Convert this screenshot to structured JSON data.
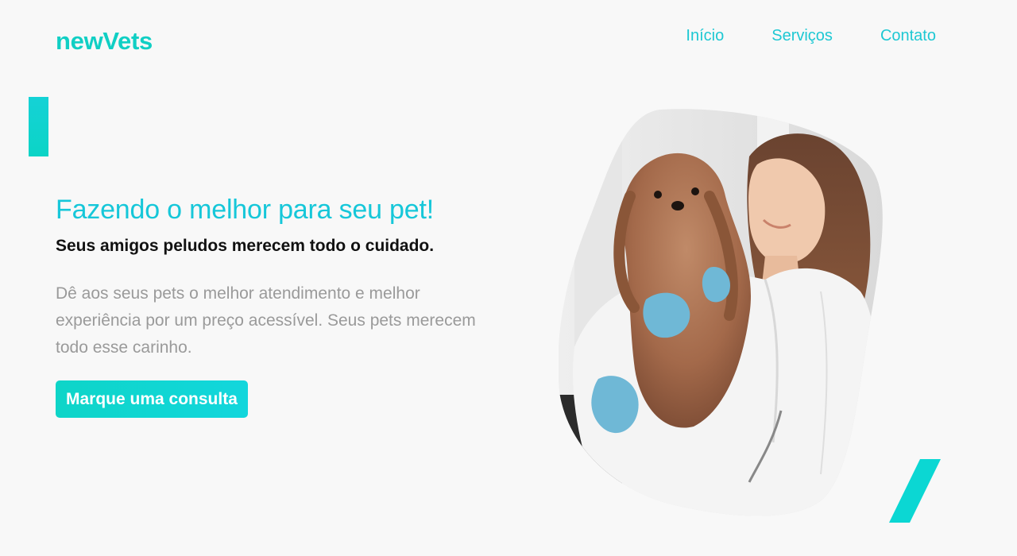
{
  "header": {
    "logo": "newVets",
    "nav": [
      {
        "label": "Início"
      },
      {
        "label": "Serviços"
      },
      {
        "label": "Contato"
      }
    ]
  },
  "hero": {
    "headline": "Fazendo o melhor para seu pet!",
    "subheadline": "Seus amigos peludos merecem todo o cuidado.",
    "description": "Dê aos seus pets o melhor atendimento e melhor experiência por um preço acessível. Seus pets merecem todo esse carinho.",
    "cta_label": "Marque uma consulta"
  },
  "colors": {
    "accent": "#10cfc4",
    "nav_link": "#1ec8d3",
    "headline": "#16c7d9",
    "body_text": "#9a9a9a",
    "background": "#f8f8f8"
  },
  "image": {
    "subject": "veterinarian-holding-yorkshire-terrier"
  }
}
